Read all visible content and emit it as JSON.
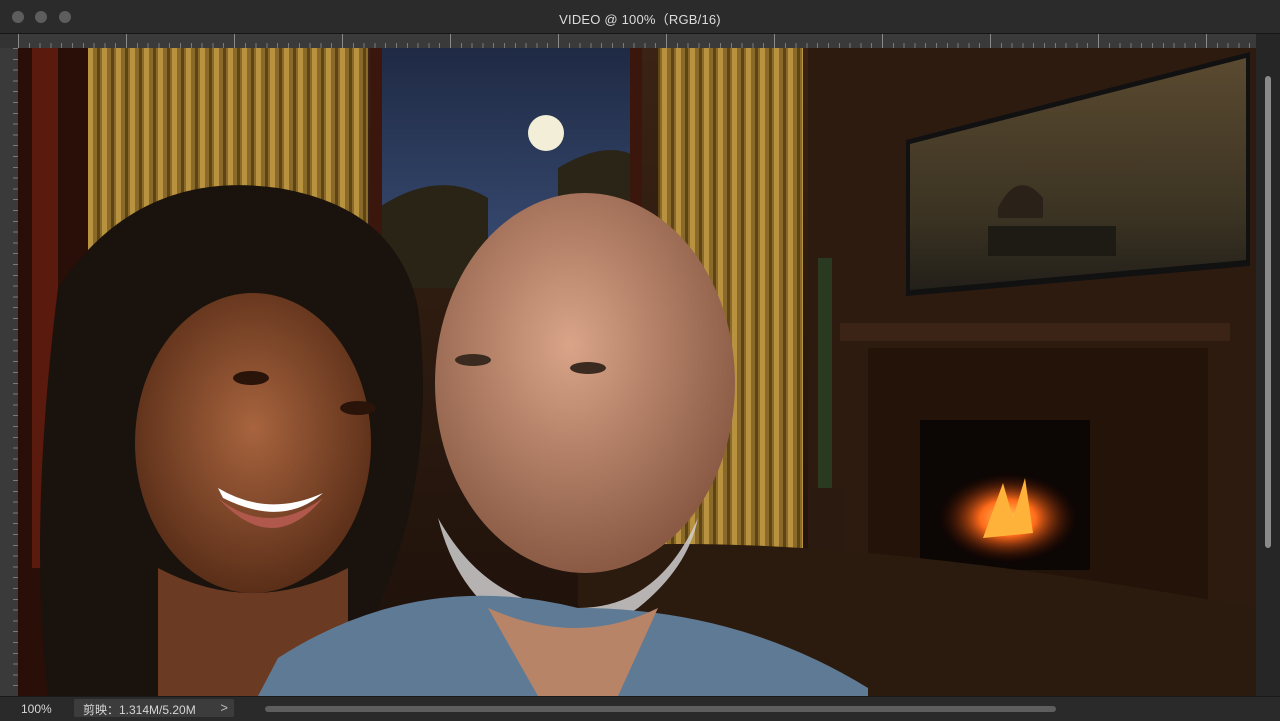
{
  "window": {
    "title": "VIDEO @ 100%（RGB/16)"
  },
  "canvas": {
    "description_icon": "photo-canvas"
  },
  "status": {
    "zoom": "100%",
    "info": "剪映：1.314M/5.20M",
    "chevron": ">"
  },
  "colors": {
    "chrome_dark": "#2b2b2b",
    "chrome_mid": "#3a3a3a",
    "traffic_light": "#5d5d5d"
  }
}
